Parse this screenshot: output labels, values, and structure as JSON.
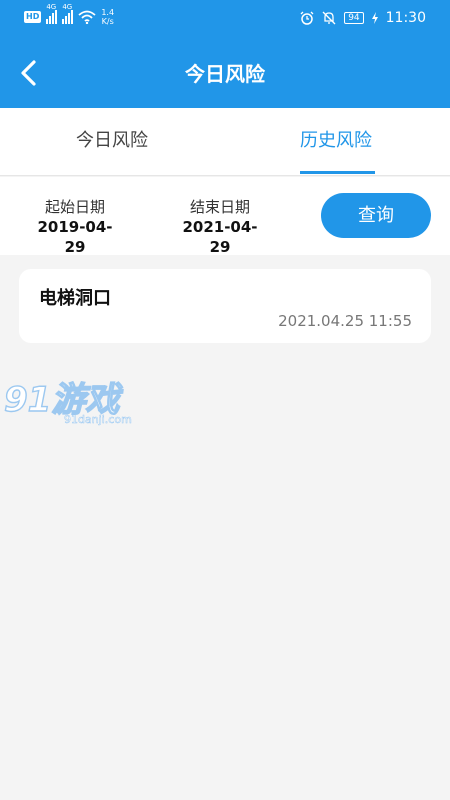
{
  "status_bar": {
    "hd": "HD",
    "net1": "4G",
    "net2": "4G",
    "speed_value": "1.4",
    "speed_unit": "K/s",
    "battery": "94",
    "time": "11:30"
  },
  "header": {
    "title": "今日风险"
  },
  "tabs": [
    {
      "label": "今日风险",
      "active": false
    },
    {
      "label": "历史风险",
      "active": true
    }
  ],
  "filter": {
    "start_label": "起始日期",
    "start_value": "2019-04-29",
    "end_label": "结束日期",
    "end_value": "2021-04-29",
    "query_label": "查询"
  },
  "records": [
    {
      "name": "电梯洞口",
      "time": "2021.04.25 11:55"
    }
  ],
  "watermark": {
    "brand": "91游戏",
    "site": "91danji.com"
  },
  "colors": {
    "primary": "#2196e8",
    "background": "#f4f4f4"
  }
}
